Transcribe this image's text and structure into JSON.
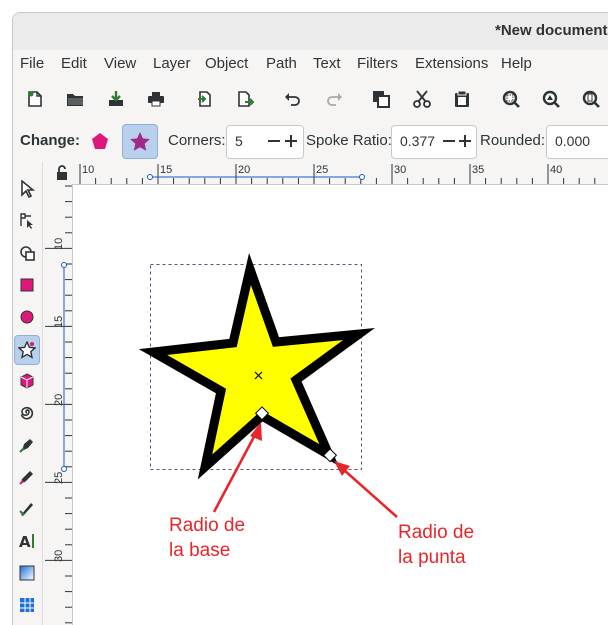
{
  "window": {
    "title": "*New document"
  },
  "menu": [
    "File",
    "Edit",
    "View",
    "Layer",
    "Object",
    "Path",
    "Text",
    "Filters",
    "Extensions",
    "Help"
  ],
  "toolbar_icons": [
    "new-document-icon",
    "open-icon",
    "import-icon",
    "print-icon",
    "page-icon",
    "export-icon",
    "undo-icon",
    "redo-icon",
    "duplicate-icon",
    "cut-icon",
    "paste-icon",
    "zoom-selection-icon",
    "zoom-drawing-icon",
    "zoom-page-icon"
  ],
  "controls": {
    "change_label": "Change:",
    "corners_label": "Corners:",
    "corners_value": "5",
    "spoke_label": "Spoke Ratio:",
    "spoke_value": "0.377",
    "rounded_label": "Rounded:",
    "rounded_value": "0.000"
  },
  "tools": [
    "selector-icon",
    "node-icon",
    "tweak-icon",
    "rectangle-icon",
    "ellipse-icon",
    "star-icon",
    "box3d-icon",
    "spiral-icon",
    "pen-icon",
    "pencil-icon",
    "calligraphy-icon",
    "text-icon",
    "gradient-icon",
    "mesh-icon"
  ],
  "hruler_labels": [
    "10",
    "15",
    "20",
    "25",
    "30",
    "35",
    "40"
  ],
  "vruler_labels": [
    "10",
    "15",
    "20",
    "25",
    "30"
  ],
  "colors": {
    "star_fill": "#ffff00",
    "star_stroke": "#000000",
    "annotation": "#e8262a",
    "active_tool": "#b9d0ec"
  },
  "annotations": {
    "base_line1": "Radio de",
    "base_line2": "la base",
    "tip_line1": "Radio de",
    "tip_line2": "la punta"
  }
}
